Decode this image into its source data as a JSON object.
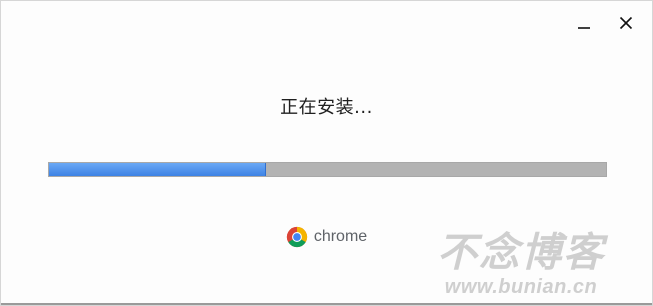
{
  "window": {
    "minimize_icon": "minimize-icon",
    "close_icon": "close-icon"
  },
  "status": {
    "text": "正在安装..."
  },
  "progress": {
    "percent": 39,
    "fill_color": "#4a8ce8",
    "track_color": "#b3b3b3"
  },
  "brand": {
    "logo_icon": "chrome-logo-icon",
    "name": "chrome"
  },
  "watermark": {
    "title": "不念博客",
    "url": "www.bunian.cn"
  }
}
